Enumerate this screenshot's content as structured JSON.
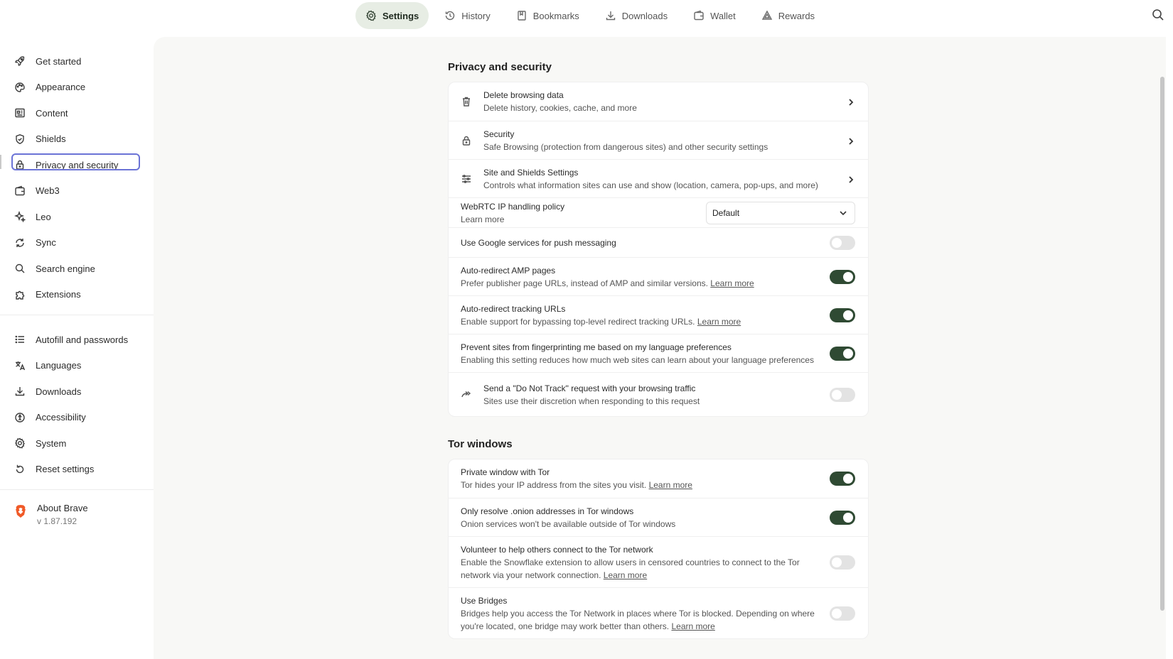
{
  "topnav": {
    "tabs": [
      {
        "label": "Settings",
        "icon": "gear-icon",
        "active": true
      },
      {
        "label": "History",
        "icon": "history-icon",
        "active": false
      },
      {
        "label": "Bookmarks",
        "icon": "bookmark-icon",
        "active": false
      },
      {
        "label": "Downloads",
        "icon": "download-icon",
        "active": false
      },
      {
        "label": "Wallet",
        "icon": "wallet-icon",
        "active": false
      },
      {
        "label": "Rewards",
        "icon": "rewards-icon",
        "active": false
      }
    ]
  },
  "sidebar": {
    "items": [
      {
        "label": "Get started",
        "icon": "rocket-icon"
      },
      {
        "label": "Appearance",
        "icon": "palette-icon"
      },
      {
        "label": "Content",
        "icon": "content-icon"
      },
      {
        "label": "Shields",
        "icon": "shield-icon"
      },
      {
        "label": "Privacy and security",
        "icon": "lock-icon",
        "active": true
      },
      {
        "label": "Web3",
        "icon": "wallet-icon"
      },
      {
        "label": "Leo",
        "icon": "sparkle-icon"
      },
      {
        "label": "Sync",
        "icon": "sync-icon"
      },
      {
        "label": "Search engine",
        "icon": "search-icon"
      },
      {
        "label": "Extensions",
        "icon": "puzzle-icon"
      }
    ],
    "items2": [
      {
        "label": "Autofill and passwords",
        "icon": "list-icon"
      },
      {
        "label": "Languages",
        "icon": "translate-icon"
      },
      {
        "label": "Downloads",
        "icon": "download-icon"
      },
      {
        "label": "Accessibility",
        "icon": "accessibility-icon"
      },
      {
        "label": "System",
        "icon": "gear-icon"
      },
      {
        "label": "Reset settings",
        "icon": "reset-icon"
      }
    ],
    "about": {
      "title": "About Brave",
      "version": "v 1.87.192"
    }
  },
  "privacy": {
    "title": "Privacy and security",
    "delete": {
      "title": "Delete browsing data",
      "sub": "Delete history, cookies, cache, and more"
    },
    "security": {
      "title": "Security",
      "sub": "Safe Browsing (protection from dangerous sites) and other security settings"
    },
    "site": {
      "title": "Site and Shields Settings",
      "sub": "Controls what information sites can use and show (location, camera, pop-ups, and more)"
    },
    "webrtc": {
      "title": "WebRTC IP handling policy",
      "learn": "Learn more",
      "value": "Default"
    },
    "push": {
      "title": "Use Google services for push messaging",
      "on": false
    },
    "amp": {
      "title": "Auto-redirect AMP pages",
      "sub": "Prefer publisher page URLs, instead of AMP and similar versions.",
      "learn": "Learn more",
      "on": true
    },
    "tracking": {
      "title": "Auto-redirect tracking URLs",
      "sub": "Enable support for bypassing top-level redirect tracking URLs.",
      "learn": "Learn more",
      "on": true
    },
    "fingerprint": {
      "title": "Prevent sites from fingerprinting me based on my language preferences",
      "sub": "Enabling this setting reduces how much web sites can learn about your language preferences",
      "on": true
    },
    "dnt": {
      "title": "Send a \"Do Not Track\" request with your browsing traffic",
      "sub": "Sites use their discretion when responding to this request",
      "on": false
    }
  },
  "tor": {
    "title": "Tor windows",
    "private": {
      "title": "Private window with Tor",
      "sub": "Tor hides your IP address from the sites you visit.",
      "learn": "Learn more",
      "on": true
    },
    "onion": {
      "title": "Only resolve .onion addresses in Tor windows",
      "sub": "Onion services won't be available outside of Tor windows",
      "on": true
    },
    "volunteer": {
      "title": "Volunteer to help others connect to the Tor network",
      "sub1": "Enable the Snowflake extension to allow users in censored countries to connect to the Tor",
      "sub2": "network via your network connection.",
      "learn": "Learn more",
      "on": false
    },
    "bridges": {
      "title": "Use Bridges",
      "sub1": "Bridges help you access the Tor Network in places where Tor is blocked. Depending on where",
      "sub2": "you're located, one bridge may work better than others.",
      "learn": "Learn more",
      "on": false
    }
  },
  "colors": {
    "accent": "#2f4a33",
    "focus": "#6b73d6",
    "active_tab_bg": "#e7ede4"
  }
}
